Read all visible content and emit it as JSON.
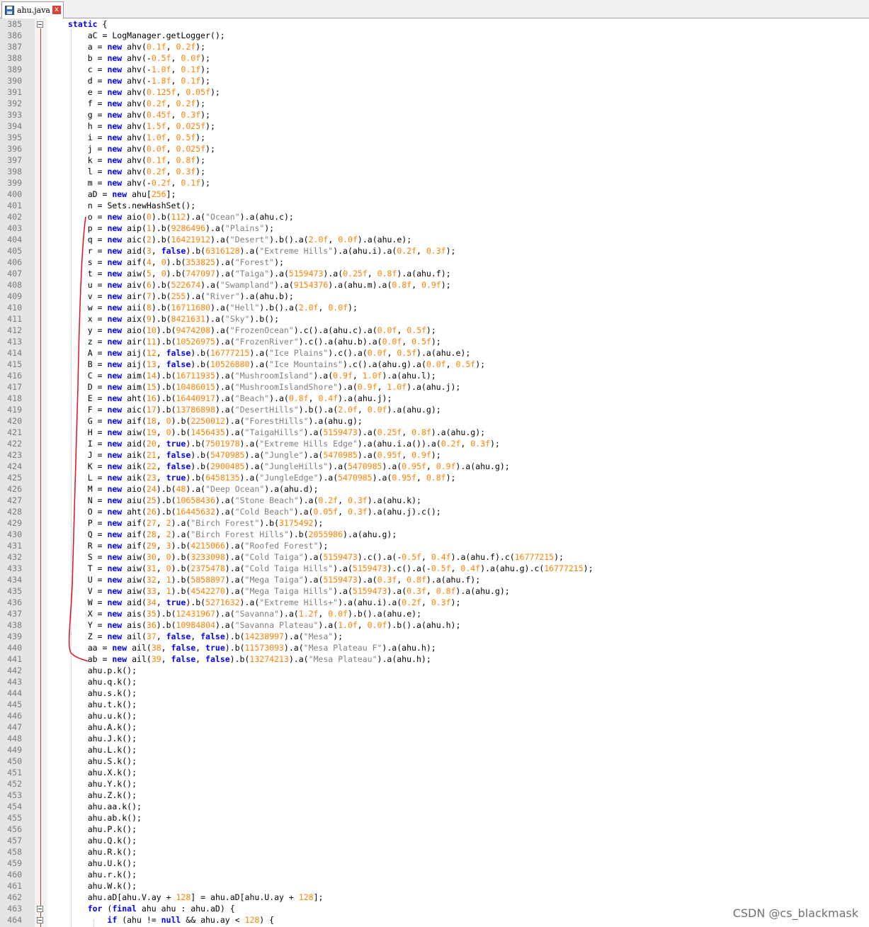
{
  "tab": {
    "label": "ahu.java",
    "close_label": "x",
    "icon": "save-disk-icon"
  },
  "first_line": 385,
  "lines": [
    "static {",
    "    aC = LogManager.getLogger();",
    "    a = new ahv(0.1f, 0.2f);",
    "    b = new ahv(-0.5f, 0.0f);",
    "    c = new ahv(-1.0f, 0.1f);",
    "    d = new ahv(-1.8f, 0.1f);",
    "    e = new ahv(0.125f, 0.05f);",
    "    f = new ahv(0.2f, 0.2f);",
    "    g = new ahv(0.45f, 0.3f);",
    "    h = new ahv(1.5f, 0.025f);",
    "    i = new ahv(1.0f, 0.5f);",
    "    j = new ahv(0.0f, 0.025f);",
    "    k = new ahv(0.1f, 0.8f);",
    "    l = new ahv(0.2f, 0.3f);",
    "    m = new ahv(-0.2f, 0.1f);",
    "    aD = new ahu[256];",
    "    n = Sets.newHashSet();",
    "    o = new aio(0).b(112).a(\"Ocean\").a(ahu.c);",
    "    p = new aip(1).b(9286496).a(\"Plains\");",
    "    q = new aic(2).b(16421912).a(\"Desert\").b().a(2.0f, 0.0f).a(ahu.e);",
    "    r = new aid(3, false).b(6316128).a(\"Extreme Hills\").a(ahu.i).a(0.2f, 0.3f);",
    "    s = new aif(4, 0).b(353825).a(\"Forest\");",
    "    t = new aiw(5, 0).b(747097).a(\"Taiga\").a(5159473).a(0.25f, 0.8f).a(ahu.f);",
    "    u = new aiv(6).b(522674).a(\"Swampland\").a(9154376).a(ahu.m).a(0.8f, 0.9f);",
    "    v = new air(7).b(255).a(\"River\").a(ahu.b);",
    "    w = new aii(8).b(16711680).a(\"Hell\").b().a(2.0f, 0.0f);",
    "    x = new aix(9).b(8421631).a(\"Sky\").b();",
    "    y = new aio(10).b(9474208).a(\"FrozenOcean\").c().a(ahu.c).a(0.0f, 0.5f);",
    "    z = new air(11).b(10526975).a(\"FrozenRiver\").c().a(ahu.b).a(0.0f, 0.5f);",
    "    A = new aij(12, false).b(16777215).a(\"Ice Plains\").c().a(0.0f, 0.5f).a(ahu.e);",
    "    B = new aij(13, false).b(10526880).a(\"Ice Mountains\").c().a(ahu.g).a(0.0f, 0.5f);",
    "    C = new aim(14).b(16711935).a(\"MushroomIsland\").a(0.9f, 1.0f).a(ahu.l);",
    "    D = new aim(15).b(10486015).a(\"MushroomIslandShore\").a(0.9f, 1.0f).a(ahu.j);",
    "    E = new aht(16).b(16440917).a(\"Beach\").a(0.8f, 0.4f).a(ahu.j);",
    "    F = new aic(17).b(13786898).a(\"DesertHills\").b().a(2.0f, 0.0f).a(ahu.g);",
    "    G = new aif(18, 0).b(2250012).a(\"ForestHills\").a(ahu.g);",
    "    H = new aiw(19, 0).b(1456435).a(\"TaigaHills\").a(5159473).a(0.25f, 0.8f).a(ahu.g);",
    "    I = new aid(20, true).b(7501978).a(\"Extreme Hills Edge\").a(ahu.i.a()).a(0.2f, 0.3f);",
    "    J = new aik(21, false).b(5470985).a(\"Jungle\").a(5470985).a(0.95f, 0.9f);",
    "    K = new aik(22, false).b(2900485).a(\"JungleHills\").a(5470985).a(0.95f, 0.9f).a(ahu.g);",
    "    L = new aik(23, true).b(6458135).a(\"JungleEdge\").a(5470985).a(0.95f, 0.8f);",
    "    M = new aio(24).b(48).a(\"Deep Ocean\").a(ahu.d);",
    "    N = new aiu(25).b(10658436).a(\"Stone Beach\").a(0.2f, 0.3f).a(ahu.k);",
    "    O = new aht(26).b(16445632).a(\"Cold Beach\").a(0.05f, 0.3f).a(ahu.j).c();",
    "    P = new aif(27, 2).a(\"Birch Forest\").b(3175492);",
    "    Q = new aif(28, 2).a(\"Birch Forest Hills\").b(2055986).a(ahu.g);",
    "    R = new aif(29, 3).b(4215066).a(\"Roofed Forest\");",
    "    S = new aiw(30, 0).b(3233098).a(\"Cold Taiga\").a(5159473).c().a(-0.5f, 0.4f).a(ahu.f).c(16777215);",
    "    T = new aiw(31, 0).b(2375478).a(\"Cold Taiga Hills\").a(5159473).c().a(-0.5f, 0.4f).a(ahu.g).c(16777215);",
    "    U = new aiw(32, 1).b(5858897).a(\"Mega Taiga\").a(5159473).a(0.3f, 0.8f).a(ahu.f);",
    "    V = new aiw(33, 1).b(4542270).a(\"Mega Taiga Hills\").a(5159473).a(0.3f, 0.8f).a(ahu.g);",
    "    W = new aid(34, true).b(5271632).a(\"Extreme Hills+\").a(ahu.i).a(0.2f, 0.3f);",
    "    X = new ais(35).b(12431967).a(\"Savanna\").a(1.2f, 0.0f).b().a(ahu.e);",
    "    Y = new ais(36).b(10984804).a(\"Savanna Plateau\").a(1.0f, 0.0f).b().a(ahu.h);",
    "    Z = new ail(37, false, false).b(14238997).a(\"Mesa\");",
    "    aa = new ail(38, false, true).b(11573093).a(\"Mesa Plateau F\").a(ahu.h);",
    "    ab = new ail(39, false, false).b(13274213).a(\"Mesa Plateau\").a(ahu.h);",
    "    ahu.p.k();",
    "    ahu.q.k();",
    "    ahu.s.k();",
    "    ahu.t.k();",
    "    ahu.u.k();",
    "    ahu.A.k();",
    "    ahu.J.k();",
    "    ahu.L.k();",
    "    ahu.S.k();",
    "    ahu.X.k();",
    "    ahu.Y.k();",
    "    ahu.Z.k();",
    "    ahu.aa.k();",
    "    ahu.ab.k();",
    "    ahu.P.k();",
    "    ahu.Q.k();",
    "    ahu.R.k();",
    "    ahu.U.k();",
    "    ahu.r.k();",
    "    ahu.W.k();",
    "    ahu.aD[ahu.V.ay + 128] = ahu.aD[ahu.U.ay + 128];",
    "    for (final ahu ahu : ahu.aD) {",
    "        if (ahu != null && ahu.ay < 128) {"
  ],
  "keywords": [
    "static",
    "new",
    "false",
    "true",
    "final",
    "for",
    "if",
    "null"
  ],
  "colors": {
    "keyword": "#0000ff",
    "number": "#ff8000",
    "string": "#808080",
    "line_number": "#7a7a7a",
    "gutter": "#e4e4e4",
    "annotation": "#e0101a"
  },
  "watermark": "CSDN @cs_blackmask"
}
